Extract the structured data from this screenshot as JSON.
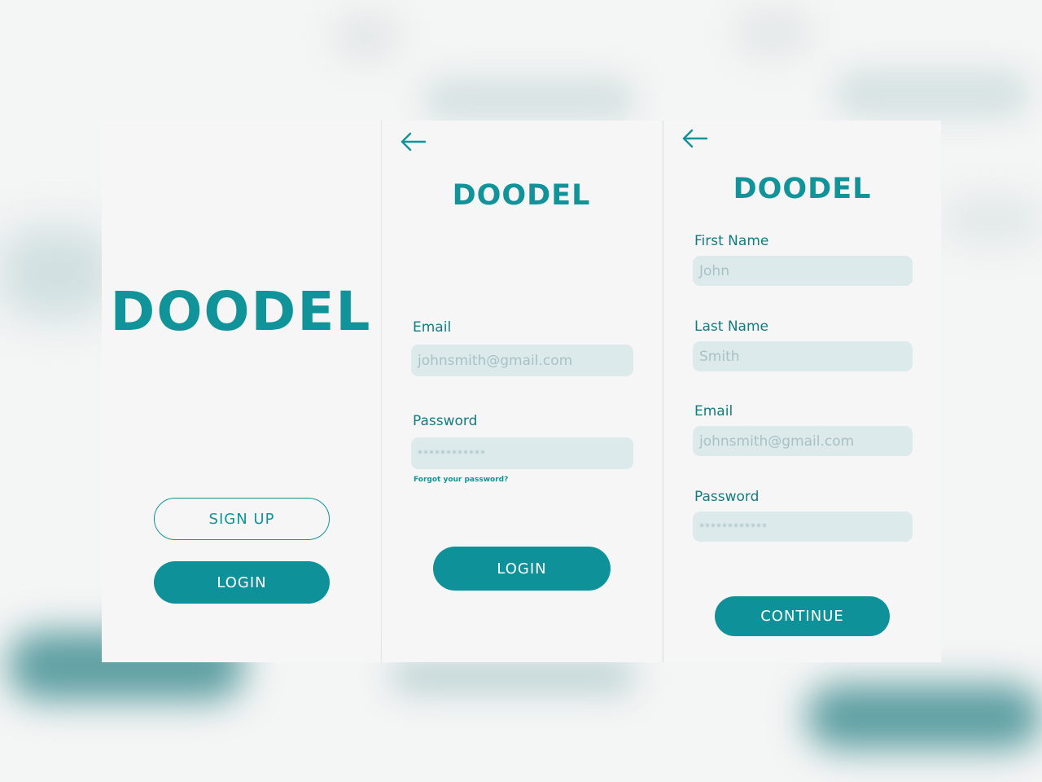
{
  "app": {
    "brand": "DOODEL"
  },
  "welcome": {
    "signup_label": "SIGN UP",
    "login_label": "LOGIN"
  },
  "login": {
    "email_label": "Email",
    "email_placeholder": "johnsmith@gmail.com",
    "password_label": "Password",
    "password_placeholder": "************",
    "forgot_label": "Forgot your password?",
    "login_label": "LOGIN"
  },
  "signup": {
    "first_name_label": "First Name",
    "first_name_placeholder": "John",
    "last_name_label": "Last Name",
    "last_name_placeholder": "Smith",
    "email_label": "Email",
    "email_placeholder": "johnsmith@gmail.com",
    "password_label": "Password",
    "password_placeholder": "************",
    "continue_label": "CONTINUE"
  },
  "icons": {
    "back": "arrow-left-icon"
  },
  "colors": {
    "accent": "#0f9199",
    "input_bg": "#dceaec",
    "label": "#137b82",
    "background": "#f4f5f5"
  }
}
